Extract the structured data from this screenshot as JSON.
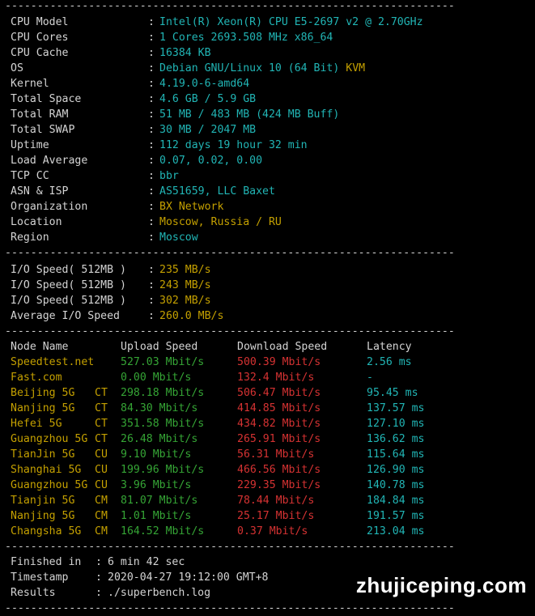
{
  "separator": "----------------------------------------------------------------------",
  "system": [
    {
      "key": "CPU Model",
      "value": "Intel(R) Xeon(R) CPU E5-2697 v2 @ 2.70GHz",
      "extra": ""
    },
    {
      "key": "CPU Cores",
      "value": "1 Cores 2693.508 MHz x86_64",
      "extra": ""
    },
    {
      "key": "CPU Cache",
      "value": "16384 KB",
      "extra": ""
    },
    {
      "key": "OS",
      "value": "Debian GNU/Linux 10 (64 Bit)",
      "extra": "KVM"
    },
    {
      "key": "Kernel",
      "value": "4.19.0-6-amd64",
      "extra": ""
    },
    {
      "key": "Total Space",
      "value": "4.6 GB / 5.9 GB",
      "extra": ""
    },
    {
      "key": "Total RAM",
      "value": "51 MB / 483 MB (424 MB Buff)",
      "extra": ""
    },
    {
      "key": "Total SWAP",
      "value": "30 MB / 2047 MB",
      "extra": ""
    },
    {
      "key": "Uptime",
      "value": "112 days 19 hour 32 min",
      "extra": ""
    },
    {
      "key": "Load Average",
      "value": "0.07, 0.02, 0.00",
      "extra": ""
    },
    {
      "key": "TCP CC",
      "value": "bbr",
      "extra": ""
    },
    {
      "key": "ASN & ISP",
      "value": "AS51659, LLC Baxet",
      "extra": ""
    },
    {
      "key": "Organization",
      "value": "BX Network",
      "extra": ""
    },
    {
      "key": "Location",
      "value": "Moscow, Russia / RU",
      "extra": ""
    },
    {
      "key": "Region",
      "value": "Moscow",
      "extra": ""
    }
  ],
  "io": [
    {
      "key": "I/O Speed( 512MB )",
      "value": "235 MB/s"
    },
    {
      "key": "I/O Speed( 512MB )",
      "value": "243 MB/s"
    },
    {
      "key": "I/O Speed( 512MB )",
      "value": "302 MB/s"
    },
    {
      "key": "Average I/O Speed",
      "value": "260.0 MB/s"
    }
  ],
  "speed_header": {
    "node": "Node Name",
    "upload": "Upload Speed",
    "download": "Download Speed",
    "latency": "Latency"
  },
  "speed": [
    {
      "node": "Speedtest.net",
      "isp": "",
      "upload": "527.03 Mbit/s",
      "download": "500.39 Mbit/s",
      "latency": "2.56 ms"
    },
    {
      "node": "Fast.com",
      "isp": "",
      "upload": "0.00 Mbit/s",
      "download": "132.4 Mbit/s",
      "latency": "-"
    },
    {
      "node": "Beijing 5G",
      "isp": "CT",
      "upload": "298.18 Mbit/s",
      "download": "506.47 Mbit/s",
      "latency": "95.45 ms"
    },
    {
      "node": "Nanjing 5G",
      "isp": "CT",
      "upload": "84.30 Mbit/s",
      "download": "414.85 Mbit/s",
      "latency": "137.57 ms"
    },
    {
      "node": "Hefei 5G",
      "isp": "CT",
      "upload": "351.58 Mbit/s",
      "download": "434.82 Mbit/s",
      "latency": "127.10 ms"
    },
    {
      "node": "Guangzhou 5G",
      "isp": "CT",
      "upload": "26.48 Mbit/s",
      "download": "265.91 Mbit/s",
      "latency": "136.62 ms"
    },
    {
      "node": "TianJin 5G",
      "isp": "CU",
      "upload": "9.10 Mbit/s",
      "download": "56.31 Mbit/s",
      "latency": "115.64 ms"
    },
    {
      "node": "Shanghai 5G",
      "isp": "CU",
      "upload": "199.96 Mbit/s",
      "download": "466.56 Mbit/s",
      "latency": "126.90 ms"
    },
    {
      "node": "Guangzhou 5G",
      "isp": "CU",
      "upload": "3.96 Mbit/s",
      "download": "229.35 Mbit/s",
      "latency": "140.78 ms"
    },
    {
      "node": "Tianjin 5G",
      "isp": "CM",
      "upload": "81.07 Mbit/s",
      "download": "78.44 Mbit/s",
      "latency": "184.84 ms"
    },
    {
      "node": "Nanjing 5G",
      "isp": "CM",
      "upload": "1.01 Mbit/s",
      "download": "25.17 Mbit/s",
      "latency": "191.57 ms"
    },
    {
      "node": "Changsha 5G",
      "isp": "CM",
      "upload": "164.52 Mbit/s",
      "download": "0.37 Mbit/s",
      "latency": "213.04 ms"
    }
  ],
  "footer": [
    {
      "key": "Finished in",
      "value": "6 min 42 sec"
    },
    {
      "key": "Timestamp",
      "value": "2020-04-27 19:12:00 GMT+8"
    },
    {
      "key": "Results",
      "value": "./superbench.log"
    }
  ],
  "watermark": "zhujiceping.com",
  "colors": {
    "background": "#000000",
    "cyan": "#21b5b5",
    "yellow": "#c4a000",
    "green": "#35a535",
    "red": "#d53232",
    "text": "#d4d4d4"
  }
}
